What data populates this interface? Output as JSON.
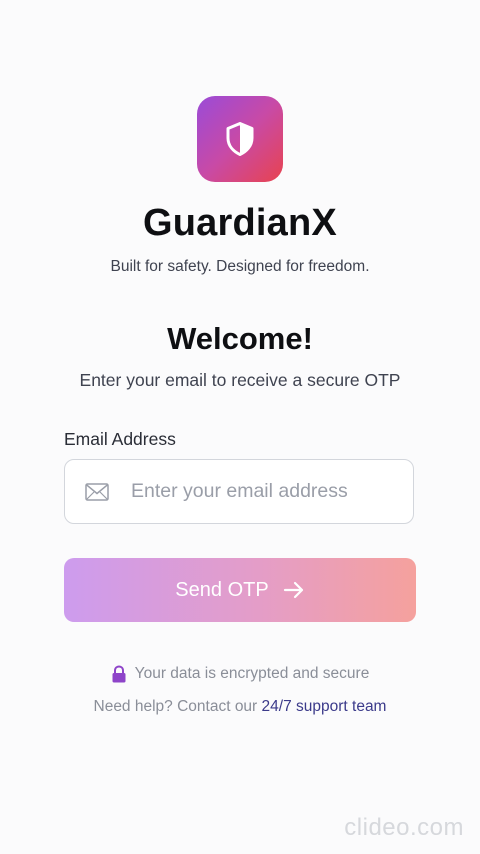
{
  "brand": {
    "logo_icon": "shield-icon",
    "gradient": [
      "#9a4bd8",
      "#e8434f"
    ],
    "title": "GuardianX",
    "tagline": "Built for safety. Designed for freedom."
  },
  "welcome": {
    "heading": "Welcome!",
    "subtitle": "Enter your email to receive a secure OTP"
  },
  "email_field": {
    "label": "Email Address",
    "icon": "mail-icon",
    "placeholder": "Enter your email address",
    "value": ""
  },
  "send_button": {
    "label": "Send OTP",
    "icon": "arrow-right-icon",
    "gradient": [
      "#cd9cee",
      "#f5a19d"
    ]
  },
  "footer": {
    "secure_icon": "lock-icon",
    "secure_text": "Your data is encrypted and secure",
    "help_prefix": "Need help? Contact our",
    "help_link": "24/7 support team",
    "link_color": "#3b3a8a"
  },
  "watermark": "clideo.com"
}
